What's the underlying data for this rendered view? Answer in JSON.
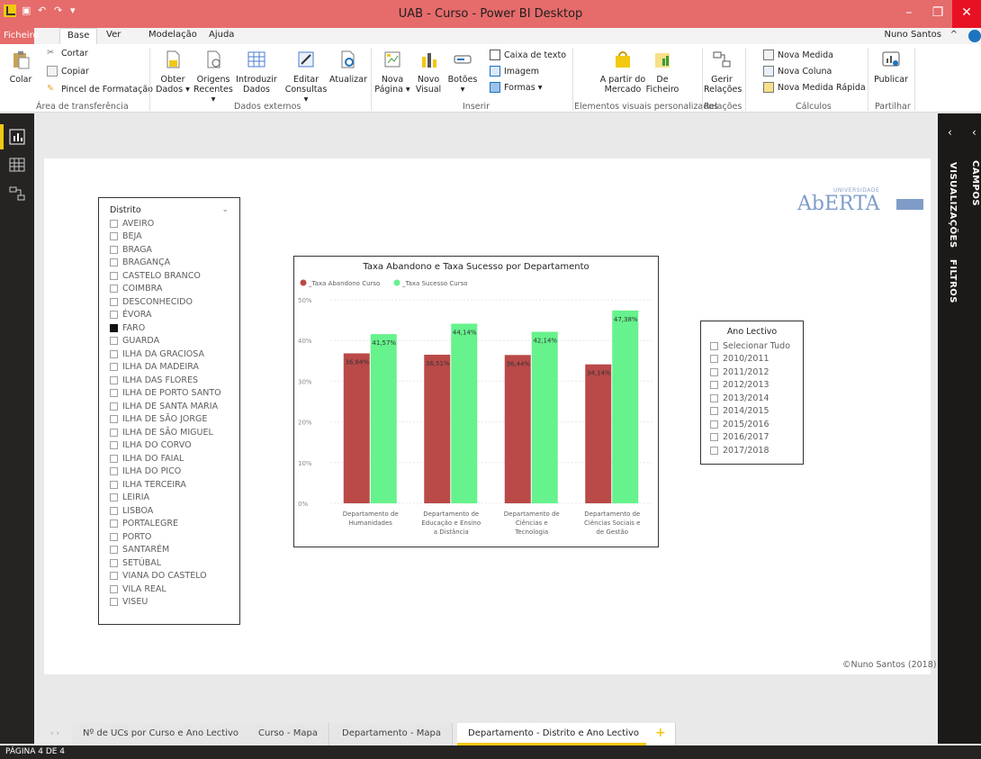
{
  "window": {
    "title": "UAB - Curso - Power BI Desktop"
  },
  "menu": {
    "file": "Ficheiro",
    "tabs": [
      "Base",
      "Ver",
      "Modelação",
      "Ajuda"
    ],
    "user": "Nuno Santos"
  },
  "ribbon": {
    "clipboard": {
      "paste": "Colar",
      "cut": "Cortar",
      "copy": "Copiar",
      "format_painter": "Pincel de Formatação",
      "group": "Área de transferência"
    },
    "external": {
      "get_data": [
        "Obter",
        "Dados ▾"
      ],
      "recent": [
        "Origens",
        "Recentes ▾"
      ],
      "enter": [
        "Introduzir",
        "Dados"
      ],
      "edit": [
        "Editar",
        "Consultas ▾"
      ],
      "refresh": "Atualizar",
      "group": "Dados externos"
    },
    "insert": {
      "new_page": [
        "Nova",
        "Página ▾"
      ],
      "new_visual": [
        "Novo",
        "Visual"
      ],
      "buttons": [
        "Botões",
        "▾"
      ],
      "textbox": "Caixa de texto",
      "image": "Imagem",
      "shapes": "Formas ▾",
      "group": "Inserir"
    },
    "custom": {
      "marketplace": [
        "A partir do",
        "Mercado"
      ],
      "file": [
        "De",
        "Ficheiro"
      ],
      "group": "Elementos visuais personalizados"
    },
    "relations": {
      "manage": [
        "Gerir",
        "Relações"
      ],
      "group": "Relações"
    },
    "calc": {
      "measure": "Nova Medida",
      "column": "Nova Coluna",
      "quick": "Nova Medida Rápida",
      "group": "Cálculos"
    },
    "share": {
      "publish": "Publicar",
      "group": "Partilhar"
    }
  },
  "panes": {
    "visualizations": "VISUALIZAÇÕES",
    "filters": "FILTROS",
    "fields": "CAMPOS"
  },
  "slicer_distrito": {
    "title": "Distrito",
    "items": [
      "AVEIRO",
      "BEJA",
      "BRAGA",
      "BRAGANÇA",
      "CASTELO BRANCO",
      "COIMBRA",
      "DESCONHECIDO",
      "ÉVORA",
      "FARO",
      "GUARDA",
      "ILHA DA GRACIOSA",
      "ILHA DA MADEIRA",
      "ILHA DAS FLORES",
      "ILHA DE PORTO SANTO",
      "ILHA DE SANTA MARIA",
      "ILHA DE SÃO JORGE",
      "ILHA DE SÃO MIGUEL",
      "ILHA DO CORVO",
      "ILHA DO FAIAL",
      "ILHA DO PICO",
      "ILHA TERCEIRA",
      "LEIRIA",
      "LISBOA",
      "PORTALEGRE",
      "PORTO",
      "SANTARÉM",
      "SETÚBAL",
      "VIANA DO CASTELO",
      "VILA REAL",
      "VISEU"
    ],
    "selected": "FARO"
  },
  "slicer_ano": {
    "title": "Ano Lectivo",
    "items": [
      "Selecionar Tudo",
      "2010/2011",
      "2011/2012",
      "2012/2013",
      "2013/2014",
      "2014/2015",
      "2015/2016",
      "2016/2017",
      "2017/2018"
    ]
  },
  "logo": {
    "small": "UNIVERSIDADE",
    "big": "AbERTA"
  },
  "copyright": "©Nuno Santos (2018)",
  "chart_data": {
    "type": "bar",
    "title": "Taxa Abandono e Taxa Sucesso por Departamento",
    "categories": [
      [
        "Departamento de",
        "Humanidades"
      ],
      [
        "Departamento de",
        "Educação e Ensino",
        "a Distância"
      ],
      [
        "Departamento de",
        "Ciências e",
        "Tecnologia"
      ],
      [
        "Departamento de",
        "Ciências Sociais e",
        "de Gestão"
      ]
    ],
    "series": [
      {
        "name": "_Taxa Abandono Curso",
        "color": "#b94a48",
        "values": [
          36.84,
          36.51,
          36.44,
          34.14
        ],
        "labels": [
          "36,84%",
          "36,51%",
          "36,44%",
          "34,14%"
        ]
      },
      {
        "name": "_Taxa Sucesso Curso",
        "color": "#66f28c",
        "values": [
          41.57,
          44.14,
          42.14,
          47.38
        ],
        "labels": [
          "41,57%",
          "44,14%",
          "42,14%",
          "47,38%"
        ]
      }
    ],
    "yticks": [
      "0%",
      "10%",
      "20%",
      "30%",
      "40%",
      "50%"
    ],
    "ylim": [
      0,
      50
    ],
    "legend": "top-left",
    "grid": true
  },
  "page_tabs": [
    "Nº de UCs por Curso e Ano Lectivo",
    "Curso - Mapa",
    "Departamento - Mapa",
    "Departamento - Distrito e Ano Lectivo"
  ],
  "active_tab": 3,
  "add_tab": "+",
  "status": "PÁGINA 4 DE 4"
}
